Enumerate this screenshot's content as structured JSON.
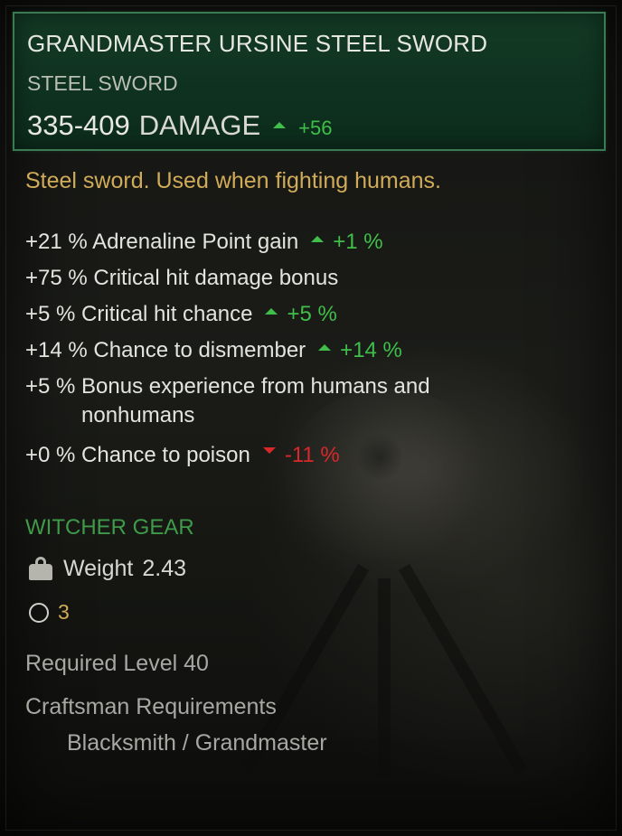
{
  "item": {
    "name": "GRANDMASTER URSINE STEEL SWORD",
    "type": "STEEL SWORD",
    "damage_value": "335-409",
    "damage_label": "DAMAGE",
    "damage_delta": "+56",
    "damage_delta_direction": "up",
    "description": "Steel sword. Used when fighting humans."
  },
  "stats": [
    {
      "text": "+21 % Adrenaline Point gain",
      "delta": "+1 %",
      "direction": "up"
    },
    {
      "text": "+75 % Critical hit damage bonus",
      "delta": "",
      "direction": "none"
    },
    {
      "text": "+5 % Critical hit chance",
      "delta": "+5 %",
      "direction": "up"
    },
    {
      "text": "+14 % Chance to dismember",
      "delta": "+14 %",
      "direction": "up"
    },
    {
      "text_line1": "+5 % Bonus experience from humans and",
      "text_line2": "nonhumans",
      "delta": "",
      "direction": "none"
    },
    {
      "text": "+0 % Chance to poison",
      "delta": "-11 %",
      "direction": "down"
    }
  ],
  "gear_label": "WITCHER GEAR",
  "weight": {
    "label": "Weight",
    "value": "2.43",
    "icon": "weight-icon"
  },
  "slots": {
    "value": "3",
    "icon": "slot-circle-icon"
  },
  "required_level": "Required Level 40",
  "craftsman": {
    "label": "Craftsman Requirements",
    "value": "Blacksmith / Grandmaster"
  },
  "colors": {
    "header_bg": "#0f3220",
    "header_border": "#3b7a52",
    "positive": "#3fbf4a",
    "negative": "#d8282a",
    "description": "#d0ab58",
    "gear": "#3f9a4a"
  }
}
